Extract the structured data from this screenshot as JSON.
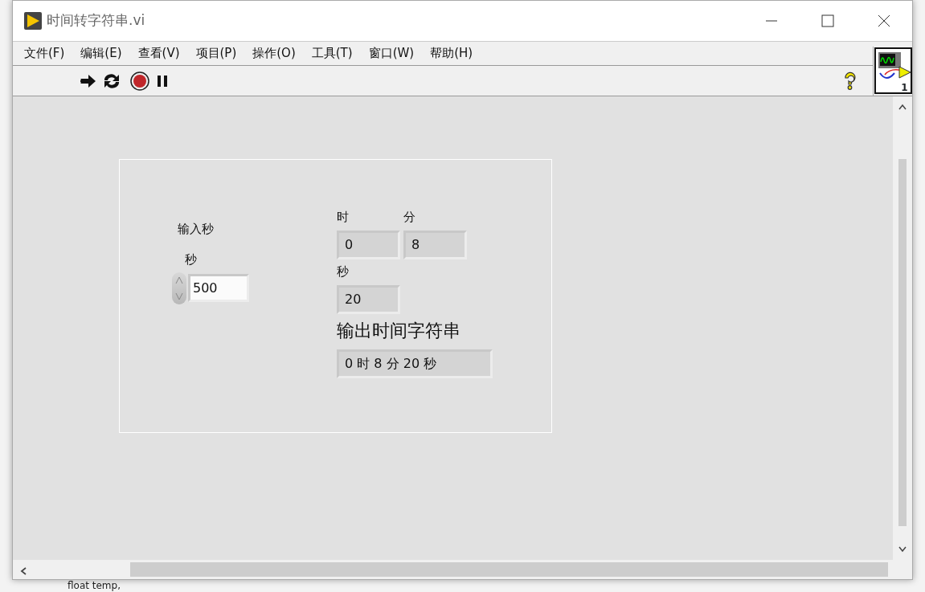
{
  "window": {
    "title": "时间转字符串.vi"
  },
  "menu": [
    "文件(F)",
    "编辑(E)",
    "查看(V)",
    "项目(P)",
    "操作(O)",
    "工具(T)",
    "窗口(W)",
    "帮助(H)"
  ],
  "connector_pane": {
    "number": "1"
  },
  "panel": {
    "items": [
      {
        "kind": "control",
        "label": "输入秒",
        "caption": "秒",
        "value": "500"
      },
      {
        "kind": "indicator",
        "label": "时",
        "value": "0"
      },
      {
        "kind": "indicator",
        "label": "分",
        "value": "8"
      },
      {
        "kind": "indicator",
        "label": "秒",
        "value": "20"
      },
      {
        "kind": "string",
        "label": "输出时间字符串",
        "value": "0 时 8 分 20 秒"
      }
    ]
  },
  "background": {
    "text": "float temp,"
  }
}
